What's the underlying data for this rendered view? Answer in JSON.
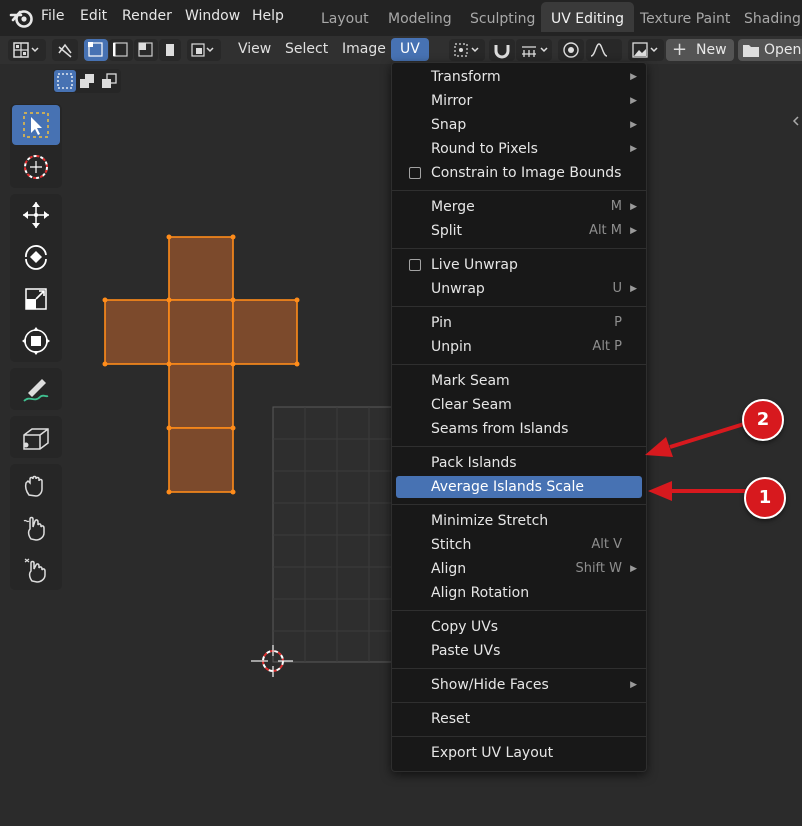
{
  "top_menu": [
    "File",
    "Edit",
    "Render",
    "Window",
    "Help"
  ],
  "workspace_tabs": [
    {
      "label": "Layout"
    },
    {
      "label": "Modeling"
    },
    {
      "label": "Sculpting"
    },
    {
      "label": "UV Editing",
      "active": true
    },
    {
      "label": "Texture Paint"
    },
    {
      "label": "Shading"
    }
  ],
  "header_menus": {
    "view": "View",
    "select": "Select",
    "image": "Image",
    "uv": "UV"
  },
  "header_buttons": {
    "new": "New",
    "open": "Open"
  },
  "uv_menu": {
    "items": [
      {
        "label": "Transform",
        "submenu": true
      },
      {
        "label": "Mirror",
        "submenu": true
      },
      {
        "label": "Snap",
        "submenu": true
      },
      {
        "label": "Round to Pixels",
        "submenu": true
      },
      {
        "label": "Constrain to Image Bounds",
        "checkbox": false
      },
      {
        "label": "Merge",
        "shortcut": "M",
        "submenu": true
      },
      {
        "label": "Split",
        "shortcut": "Alt M",
        "submenu": true
      },
      {
        "label": "Live Unwrap",
        "checkbox": false
      },
      {
        "label": "Unwrap",
        "shortcut": "U",
        "submenu": true
      },
      {
        "label": "Pin",
        "shortcut": "P"
      },
      {
        "label": "Unpin",
        "shortcut": "Alt P"
      },
      {
        "label": "Mark Seam"
      },
      {
        "label": "Clear Seam"
      },
      {
        "label": "Seams from Islands"
      },
      {
        "label": "Pack Islands"
      },
      {
        "label": "Average Islands Scale",
        "highlighted": true
      },
      {
        "label": "Minimize Stretch"
      },
      {
        "label": "Stitch",
        "shortcut": "Alt V"
      },
      {
        "label": "Align",
        "shortcut": "Shift W",
        "submenu": true
      },
      {
        "label": "Align Rotation"
      },
      {
        "label": "Copy UVs"
      },
      {
        "label": "Paste UVs"
      },
      {
        "label": "Show/Hide Faces",
        "submenu": true
      },
      {
        "label": "Reset"
      },
      {
        "label": "Export UV Layout"
      }
    ]
  },
  "annotations": [
    {
      "label": "1"
    },
    {
      "label": "2"
    }
  ],
  "colors": {
    "accent": "#4772b3",
    "uv_face_fill": "#7c4a2c",
    "uv_vertex": "#ff8c1a",
    "annotation_red": "#d7191e"
  }
}
